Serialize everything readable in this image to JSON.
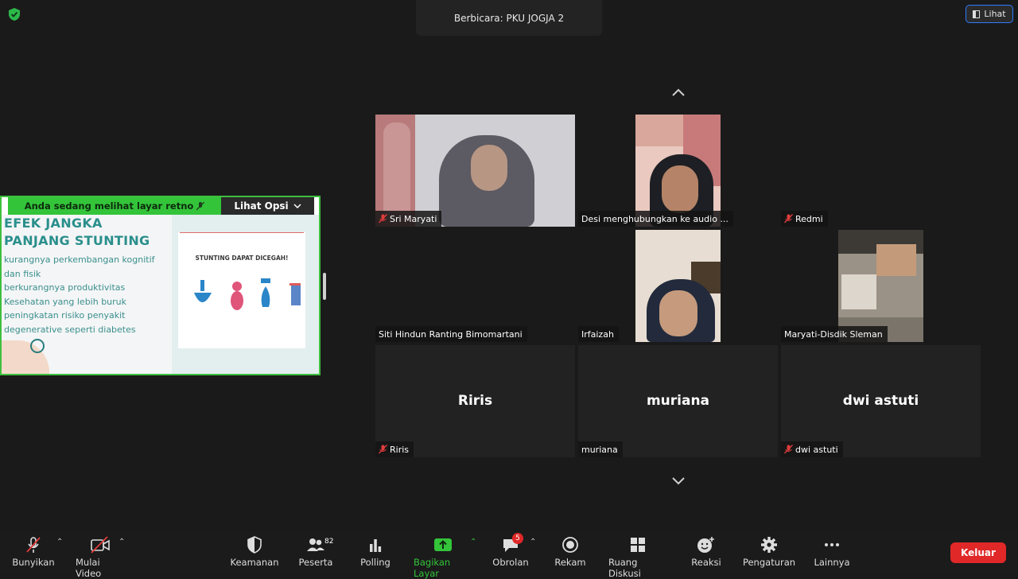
{
  "header": {
    "speaker_text": "Berbicara: PKU JOGJA 2",
    "view_label": "Lihat"
  },
  "share": {
    "notice": "Anda sedang melihat layar",
    "sharer": "retno",
    "options_label": "Lihat Opsi",
    "slide": {
      "title_line1": "EFEK JANGKA",
      "title_line2": "PANJANG STUNTING",
      "bullets": [
        "kurangnya perkembangan  kognitif",
        "dan fisik",
        "berkurangnya produktivitas",
        "Kesehatan yang lebih buruk",
        "peningkatan risiko penyakit",
        "degenerative seperti diabetes"
      ],
      "card_title": "STUNTING DAPAT DICEGAH!"
    }
  },
  "participants": [
    {
      "name": "Sri Maryati",
      "muted": true
    },
    {
      "name": "Desi menghubungkan ke audio ...",
      "muted": false
    },
    {
      "name": "Redmi",
      "muted": true
    },
    {
      "name": "Siti Hindun Ranting Bimomartani",
      "muted": false
    },
    {
      "name": "Irfaizah",
      "muted": false
    },
    {
      "name": "Maryati-Disdik Sleman",
      "muted": false
    },
    {
      "name": "Riris",
      "muted": true,
      "display": "Riris"
    },
    {
      "name": "muriana",
      "muted": false,
      "display": "muriana"
    },
    {
      "name": "dwi astuti",
      "muted": true,
      "display": "dwi astuti"
    }
  ],
  "toolbar": {
    "audio": "Bunyikan",
    "video": "Mulai Video",
    "security": "Keamanan",
    "participants": "Peserta",
    "participants_count": "82",
    "polling": "Polling",
    "share": "Bagikan Layar",
    "chat": "Obrolan",
    "chat_badge": "5",
    "record": "Rekam",
    "breakout": "Ruang Diskusi",
    "reactions": "Reaksi",
    "settings": "Pengaturan",
    "more": "Lainnya",
    "leave": "Keluar"
  },
  "colors": {
    "accent_green": "#33c43a",
    "leave_red": "#e02828",
    "mute_red": "#e03c3c",
    "slide_teal": "#2a8f8c"
  }
}
